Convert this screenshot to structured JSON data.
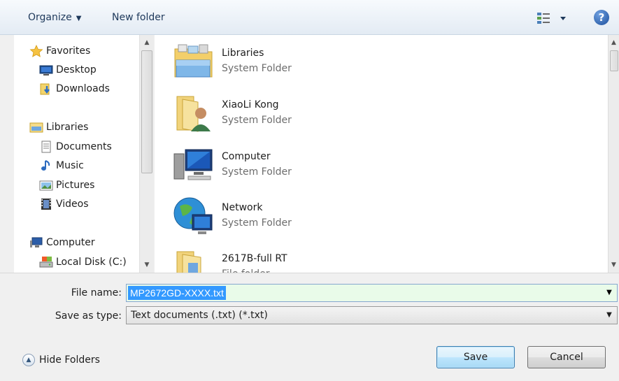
{
  "toolbar": {
    "organize_label": "Organize",
    "new_folder_label": "New folder",
    "help_label": "?"
  },
  "nav": {
    "favorites": {
      "label": "Favorites",
      "items": [
        {
          "label": "Desktop",
          "icon": "desktop-icon"
        },
        {
          "label": "Downloads",
          "icon": "downloads-icon"
        }
      ]
    },
    "libraries": {
      "label": "Libraries",
      "items": [
        {
          "label": "Documents",
          "icon": "documents-icon"
        },
        {
          "label": "Music",
          "icon": "music-icon"
        },
        {
          "label": "Pictures",
          "icon": "pictures-icon"
        },
        {
          "label": "Videos",
          "icon": "videos-icon"
        }
      ]
    },
    "computer": {
      "label": "Computer",
      "items": [
        {
          "label": "Local Disk (C:)",
          "icon": "local-disk-icon"
        }
      ]
    }
  },
  "content": {
    "items": [
      {
        "name": "Libraries",
        "type": "System Folder",
        "icon": "libraries-folder-icon"
      },
      {
        "name": "XiaoLi Kong",
        "type": "System Folder",
        "icon": "user-folder-icon"
      },
      {
        "name": "Computer",
        "type": "System Folder",
        "icon": "computer-icon"
      },
      {
        "name": "Network",
        "type": "System Folder",
        "icon": "network-icon"
      },
      {
        "name": "2617B-full RT",
        "type": "File folder",
        "icon": "folder-icon"
      }
    ]
  },
  "form": {
    "file_name_label": "File name:",
    "file_name_value": "MP2672GD-XXXX.txt",
    "save_type_label": "Save as type:",
    "save_type_value": "Text documents (.txt) (*.txt)"
  },
  "footer": {
    "hide_folders_label": "Hide Folders",
    "save_label": "Save",
    "cancel_label": "Cancel"
  },
  "colors": {
    "selection": "#3399ff",
    "input_bg": "#e9fbe9",
    "toolbar_text": "#1e395b"
  }
}
